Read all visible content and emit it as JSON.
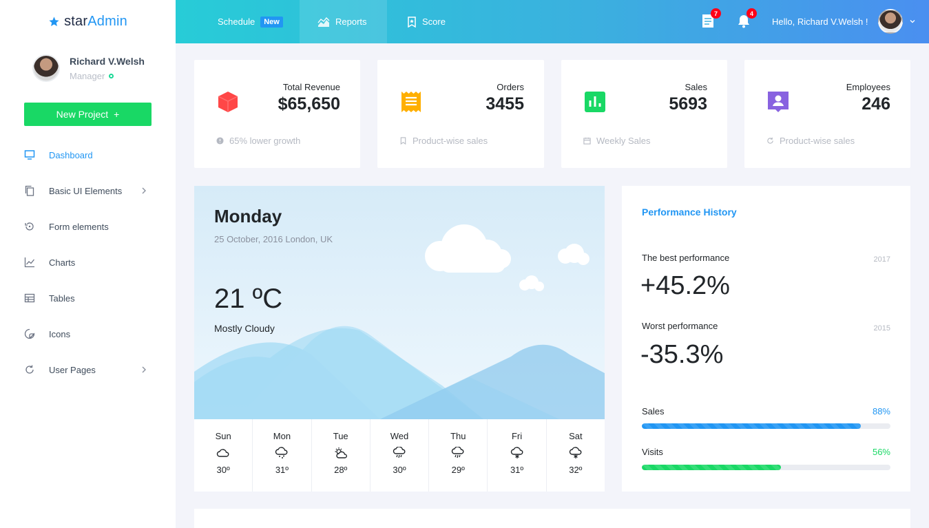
{
  "brand": {
    "name_part1": "star",
    "name_part2": "Admin"
  },
  "user": {
    "name": "Richard V.Welsh",
    "role": "Manager"
  },
  "sidebar": {
    "new_project_label": "New Project",
    "new_project_icon": "+",
    "items": [
      {
        "label": "Dashboard",
        "icon": "monitor-icon",
        "active": true
      },
      {
        "label": "Basic UI Elements",
        "icon": "copy-icon",
        "has_submenu": true
      },
      {
        "label": "Form elements",
        "icon": "restore-icon"
      },
      {
        "label": "Charts",
        "icon": "line-chart-icon"
      },
      {
        "label": "Tables",
        "icon": "table-icon"
      },
      {
        "label": "Icons",
        "icon": "sticker-icon"
      },
      {
        "label": "User Pages",
        "icon": "reload-icon",
        "has_submenu": true
      }
    ]
  },
  "topbar": {
    "schedule_label": "Schedule",
    "schedule_badge": "New",
    "reports_label": "Reports",
    "score_label": "Score",
    "messages_count": "7",
    "notifications_count": "4",
    "greeting": "Hello, Richard V.Welsh !"
  },
  "stats": [
    {
      "label": "Total Revenue",
      "value": "$65,650",
      "footer": "65% lower growth",
      "icon": "cube-icon",
      "color": "#ff4747",
      "footer_icon": "alert-circle-icon"
    },
    {
      "label": "Orders",
      "value": "3455",
      "footer": "Product-wise sales",
      "icon": "receipt-icon",
      "color": "#ffaf00",
      "footer_icon": "bookmark-icon"
    },
    {
      "label": "Sales",
      "value": "5693",
      "footer": "Weekly Sales",
      "icon": "poll-box-icon",
      "color": "#19d865",
      "footer_icon": "calendar-icon"
    },
    {
      "label": "Employees",
      "value": "246",
      "footer": "Product-wise sales",
      "icon": "account-box-icon",
      "color": "#8862e0",
      "footer_icon": "reload-icon"
    }
  ],
  "weather": {
    "day": "Monday",
    "date_location": "25 October, 2016 London, UK",
    "temperature": "21 ºC",
    "condition": "Mostly Cloudy",
    "forecast": [
      {
        "day": "Sun",
        "temp": "30º",
        "icon": "cloud-icon"
      },
      {
        "day": "Mon",
        "temp": "31º",
        "icon": "cloud-snow-icon"
      },
      {
        "day": "Tue",
        "temp": "28º",
        "icon": "partly-cloudy-icon"
      },
      {
        "day": "Wed",
        "temp": "30º",
        "icon": "cloud-rain-icon"
      },
      {
        "day": "Thu",
        "temp": "29º",
        "icon": "cloud-rain-icon"
      },
      {
        "day": "Fri",
        "temp": "31º",
        "icon": "cloud-snowflake-icon"
      },
      {
        "day": "Sat",
        "temp": "32º",
        "icon": "cloud-snowflake-icon"
      }
    ]
  },
  "performance": {
    "title": "Performance History",
    "best_label": "The best performance",
    "best_year": "2017",
    "best_value": "+45.2%",
    "worst_label": "Worst performance",
    "worst_year": "2015",
    "worst_value": "-35.3%",
    "bars": [
      {
        "label": "Sales",
        "percent_text": "88%",
        "percent": 88,
        "color": "#2196f3"
      },
      {
        "label": "Visits",
        "percent_text": "56%",
        "percent": 56,
        "color": "#19d865"
      }
    ]
  }
}
